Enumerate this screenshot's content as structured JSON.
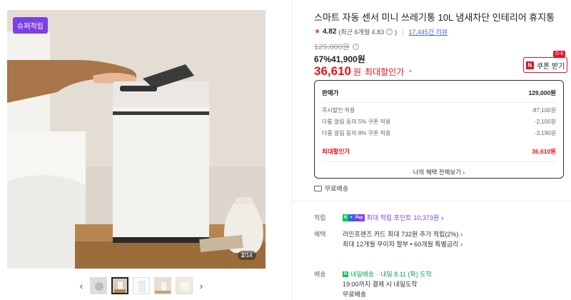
{
  "gallery": {
    "badge": "슈퍼적립",
    "page_current": "2",
    "page_total": "/14",
    "thumb_count": 5,
    "active_thumb": 2,
    "prev_arrow": "‹",
    "next_arrow": "›"
  },
  "product": {
    "title": "스마트 자동 센서 미니 쓰레기통 10L 냄새차단 인테리어 휴지통",
    "rating": "4.82",
    "rating_detail": "(최근 6개월 4.83",
    "rating_detail_close": ")",
    "review_count": "17,445건 리뷰",
    "original_price": "129,000원",
    "discount_percent": "67%",
    "discount_price": "41,900원",
    "best_price": "36,610",
    "best_price_unit": "원",
    "best_price_label": "최대할인가",
    "best_price_chevron": "⌃"
  },
  "coupon": {
    "dday": "D-6",
    "n_logo": "N",
    "label": "쿠폰 받기",
    "color": "#e8111f"
  },
  "price_box": {
    "sale_label": "판매가",
    "sale_value": "129,000원",
    "rows": [
      {
        "label": "즉시할인 적용",
        "value": "-87,100원"
      },
      {
        "label": "다룸 알림 동의 5% 쿠폰 적용",
        "value": "-2,100원"
      },
      {
        "label": "다룸 알림 동의 8% 쿠폰 적용",
        "value": "-3,190원"
      }
    ],
    "best_label": "최대할인가",
    "best_value": "36,610원",
    "more_label": "나의 혜택 전체보기",
    "more_chevron": "›"
  },
  "shipping": {
    "free_label": "무료배송"
  },
  "points": {
    "label": "적립",
    "badge_n": "N",
    "badge_plus": "+",
    "badge_card": "Pay",
    "text": "최대 적립 포인트",
    "amount": "10,373원",
    "chevron": "›"
  },
  "benefits": {
    "label": "혜택",
    "line1": "라인프렌즈 카드 최대 732원 추가 적립(2%)",
    "line2": "최대 12개월 무이자 할부 • 60개월 특별금리",
    "chevron": "›"
  },
  "delivery": {
    "label": "배송",
    "n_mark": "N",
    "type": "내일배송",
    "sep": "·",
    "arrival": "내일 8.11 (화) 도착",
    "cutoff": "19:00까지 결제 시 내일도착",
    "fee": "무료배송"
  },
  "colors": {
    "accent_red": "#e8111f",
    "purple": "#7b3fe4",
    "green": "#03c75a",
    "link_blue": "#3d6fd8"
  }
}
